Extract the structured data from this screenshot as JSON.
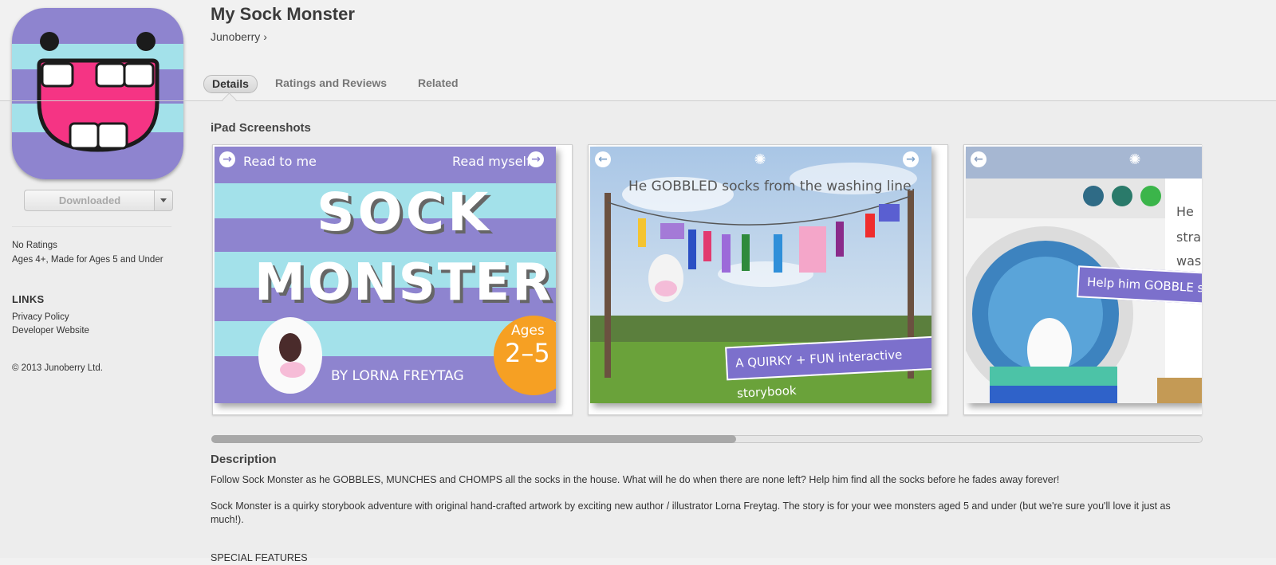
{
  "app": {
    "title": "My Sock Monster",
    "developer": "Junoberry",
    "developer_chevron": "›"
  },
  "sidebar": {
    "download_label": "Downloaded",
    "ratings": "No Ratings",
    "ages": "Ages 4+, Made for Ages 5 and Under",
    "links_title": "LINKS",
    "links": [
      "Privacy Policy",
      "Developer Website"
    ],
    "copyright": "© 2013 Junoberry Ltd."
  },
  "tabs": [
    "Details",
    "Ratings and Reviews",
    "Related"
  ],
  "screenshots": {
    "title": "iPad Screenshots",
    "shot1": {
      "read_to_me": "Read to me",
      "read_myself": "Read myself",
      "title_line1": "SOCK",
      "title_line2": "MONSTER",
      "author": "BY LORNA FREYTAG",
      "ages_label": "Ages",
      "ages_value": "2–5"
    },
    "shot2": {
      "caption": "He GOBBLED socks from the washing line.",
      "banner": "A QUIRKY + FUN interactive storybook"
    },
    "shot3": {
      "banner": "Help him GOBBLE soc",
      "side_text": [
        "He",
        "stra",
        "wash"
      ]
    }
  },
  "description": {
    "title": "Description",
    "p1": "Follow Sock Monster as he GOBBLES, MUNCHES and CHOMPS all the socks in the house. What will he do when there are none left? Help him find all the socks before he fades away forever!",
    "p2": "Sock Monster is a quirky storybook adventure with original hand-crafted artwork by exciting new author / illustrator Lorna Freytag. The story is for your wee monsters aged 5 and under (but we're sure you'll love it just as much!).",
    "p3": "SPECIAL FEATURES"
  },
  "colors": {
    "purple": "#8e84cf",
    "aqua": "#a3e1ea",
    "pink": "#f53484",
    "orange": "#f6a023",
    "banner": "#7c70cc"
  }
}
